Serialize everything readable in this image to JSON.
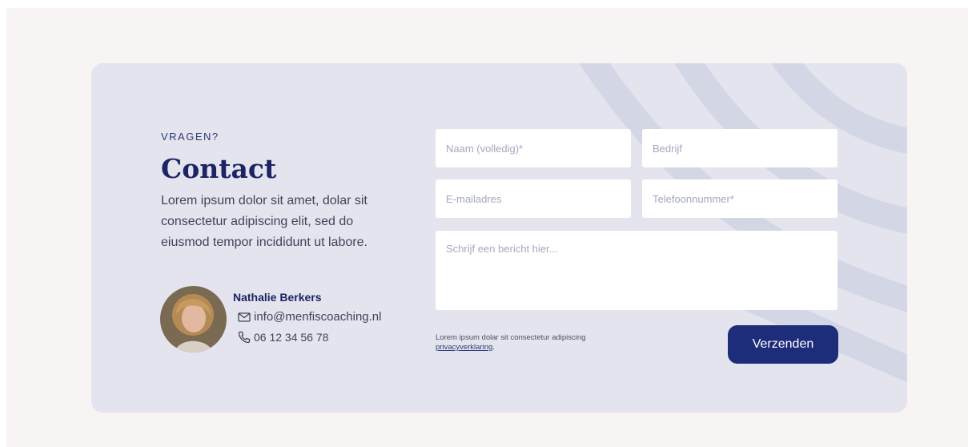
{
  "contact": {
    "eyebrow": "VRAGEN?",
    "title": "Contact",
    "intro": "Lorem ipsum dolor sit amet, dolar sit consectetur adipiscing elit, sed do eiusmod tempor incididunt ut labore.",
    "person": {
      "name": "Nathalie Berkers",
      "email": "info@menfiscoaching.nl",
      "phone": "06 12 34 56 78"
    }
  },
  "form": {
    "name_placeholder": "Naam (volledig)*",
    "company_placeholder": "Bedrijf",
    "email_placeholder": "E-mailadres",
    "phone_placeholder": "Telefoonnummer*",
    "message_placeholder": "Schrijf een bericht hier...",
    "privacy_text": "Lorem ipsum dolar sit consectetur adipiscing",
    "privacy_link": "privacyverklaring",
    "privacy_suffix": ".",
    "submit_label": "Verzenden"
  },
  "icons": {
    "email": "envelope-icon",
    "phone": "phone-icon"
  },
  "colors": {
    "page_background": "#f8f4f3",
    "card_background": "#e4e4ef",
    "stripe": "#d3d7e5",
    "accent": "#1e2d7a",
    "heading": "#1c2463"
  }
}
